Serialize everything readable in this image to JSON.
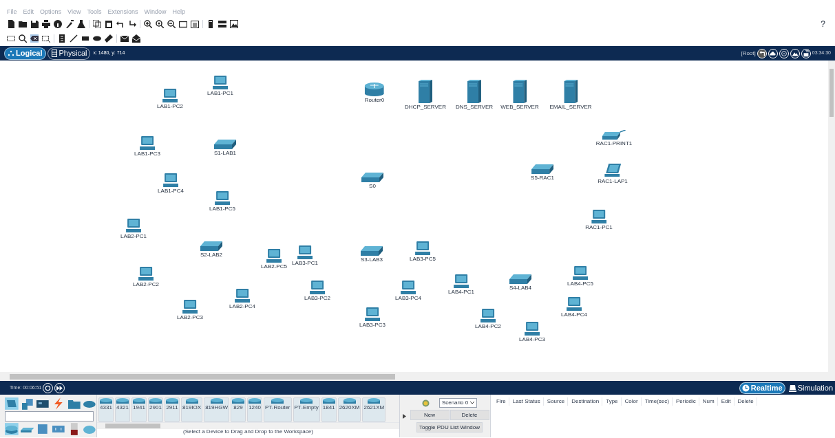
{
  "menu": [
    "File",
    "Edit",
    "Options",
    "View",
    "Tools",
    "Extensions",
    "Window",
    "Help"
  ],
  "help": "?",
  "tabs": [
    {
      "label": "Logical",
      "selected": true
    },
    {
      "label": "Physical",
      "selected": false
    }
  ],
  "coords": "x: 1480, y: 714",
  "root_label": "[Root]",
  "clock": "03:34:30",
  "devices": [
    {
      "kind": "pc",
      "label": "LAB1-PC2"
    },
    {
      "kind": "pc",
      "label": "LAB1-PC1"
    },
    {
      "kind": "router",
      "label": "Router0"
    },
    {
      "kind": "server",
      "label": "DHCP_SERVER"
    },
    {
      "kind": "server",
      "label": "DNS_SERVER"
    },
    {
      "kind": "server",
      "label": "WEB_SERVER"
    },
    {
      "kind": "server",
      "label": "EMAIL_SERVER"
    },
    {
      "kind": "printer",
      "label": "RAC1-PRINT1"
    },
    {
      "kind": "pc",
      "label": "LAB1-PC3"
    },
    {
      "kind": "switch",
      "label": "S1-LAB1"
    },
    {
      "kind": "switch",
      "label": "S0"
    },
    {
      "kind": "switch",
      "label": "S5-RAC1"
    },
    {
      "kind": "laptop",
      "label": "RAC1-LAP1"
    },
    {
      "kind": "pc",
      "label": "LAB1-PC4"
    },
    {
      "kind": "pc",
      "label": "LAB1-PC5"
    },
    {
      "kind": "pc",
      "label": "RAC1-PC1"
    },
    {
      "kind": "pc",
      "label": "LAB2-PC1"
    },
    {
      "kind": "switch",
      "label": "S2-LAB2"
    },
    {
      "kind": "pc",
      "label": "LAB2-PC5"
    },
    {
      "kind": "pc",
      "label": "LAB3-PC1"
    },
    {
      "kind": "switch",
      "label": "S3-LAB3"
    },
    {
      "kind": "pc",
      "label": "LAB3-PC5"
    },
    {
      "kind": "pc",
      "label": "LAB2-PC2"
    },
    {
      "kind": "pc",
      "label": "LAB4-PC1"
    },
    {
      "kind": "switch",
      "label": "S4-LAB4"
    },
    {
      "kind": "pc",
      "label": "LAB4-PC5"
    },
    {
      "kind": "pc",
      "label": "LAB3-PC4"
    },
    {
      "kind": "pc",
      "label": "LAB3-PC2"
    },
    {
      "kind": "pc",
      "label": "LAB2-PC4"
    },
    {
      "kind": "pc",
      "label": "LAB2-PC3"
    },
    {
      "kind": "pc",
      "label": "LAB4-PC4"
    },
    {
      "kind": "pc",
      "label": "LAB3-PC3"
    },
    {
      "kind": "pc",
      "label": "LAB4-PC2"
    },
    {
      "kind": "pc",
      "label": "LAB4-PC3"
    }
  ],
  "time": "Time: 00:06:51",
  "modes": [
    {
      "label": "Realtime",
      "selected": true
    },
    {
      "label": "Simulation",
      "selected": false
    }
  ],
  "device_models": [
    "4331",
    "4321",
    "1941",
    "2901",
    "2911",
    "819IOX",
    "819HGW",
    "829",
    "1240",
    "PT-Router",
    "PT-Empty",
    "1841",
    "2620XM",
    "2621XM"
  ],
  "hint": "(Select a Device to Drag and Drop to the Workspace)",
  "scenario": "Scenario 0",
  "buttons": [
    "New",
    "Delete"
  ],
  "toggle": "Toggle PDU List Window",
  "pdu_columns": [
    "Fire",
    "Last Status",
    "Source",
    "Destination",
    "Type",
    "Color",
    "Time(sec)",
    "Periodic",
    "Num",
    "Edit",
    "Delete"
  ]
}
